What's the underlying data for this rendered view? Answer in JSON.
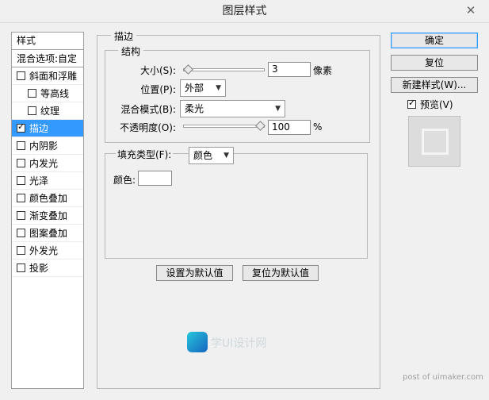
{
  "window": {
    "title": "图层样式"
  },
  "left_list": {
    "header": "样式",
    "blend_options": "混合选项:自定",
    "items": [
      {
        "label": "斜面和浮雕",
        "checked": false,
        "indent": false,
        "active": false
      },
      {
        "label": "等高线",
        "checked": false,
        "indent": true,
        "active": false
      },
      {
        "label": "纹理",
        "checked": false,
        "indent": true,
        "active": false
      },
      {
        "label": "描边",
        "checked": true,
        "indent": false,
        "active": true
      },
      {
        "label": "内阴影",
        "checked": false,
        "indent": false,
        "active": false
      },
      {
        "label": "内发光",
        "checked": false,
        "indent": false,
        "active": false
      },
      {
        "label": "光泽",
        "checked": false,
        "indent": false,
        "active": false
      },
      {
        "label": "颜色叠加",
        "checked": false,
        "indent": false,
        "active": false
      },
      {
        "label": "渐变叠加",
        "checked": false,
        "indent": false,
        "active": false
      },
      {
        "label": "图案叠加",
        "checked": false,
        "indent": false,
        "active": false
      },
      {
        "label": "外发光",
        "checked": false,
        "indent": false,
        "active": false
      },
      {
        "label": "投影",
        "checked": false,
        "indent": false,
        "active": false
      }
    ]
  },
  "stroke": {
    "group_title": "描边",
    "structure_title": "结构",
    "size_label": "大小(S):",
    "size_value": "3",
    "size_unit": "像素",
    "size_slider_fraction": 0.02,
    "position_label": "位置(P):",
    "position_value": "外部",
    "blend_mode_label": "混合模式(B):",
    "blend_mode_value": "柔光",
    "opacity_label": "不透明度(O):",
    "opacity_value": "100",
    "opacity_unit": "%",
    "opacity_slider_fraction": 1.0,
    "fill_type_label": "填充类型(F):",
    "fill_type_value": "颜色",
    "color_label": "颜色:",
    "color_value": "#ffffff",
    "set_default_button": "设置为默认值",
    "reset_default_button": "复位为默认值"
  },
  "right_panel": {
    "ok_button": "确定",
    "reset_button": "复位",
    "new_style_button": "新建样式(W)...",
    "preview_label": "预览(V)",
    "preview_checked": true
  },
  "branding": {
    "logo_text": "学UI设计网",
    "watermark": "post of uimaker.com"
  },
  "colors": {
    "selection": "#3399ff",
    "background": "#f0f0f0"
  }
}
